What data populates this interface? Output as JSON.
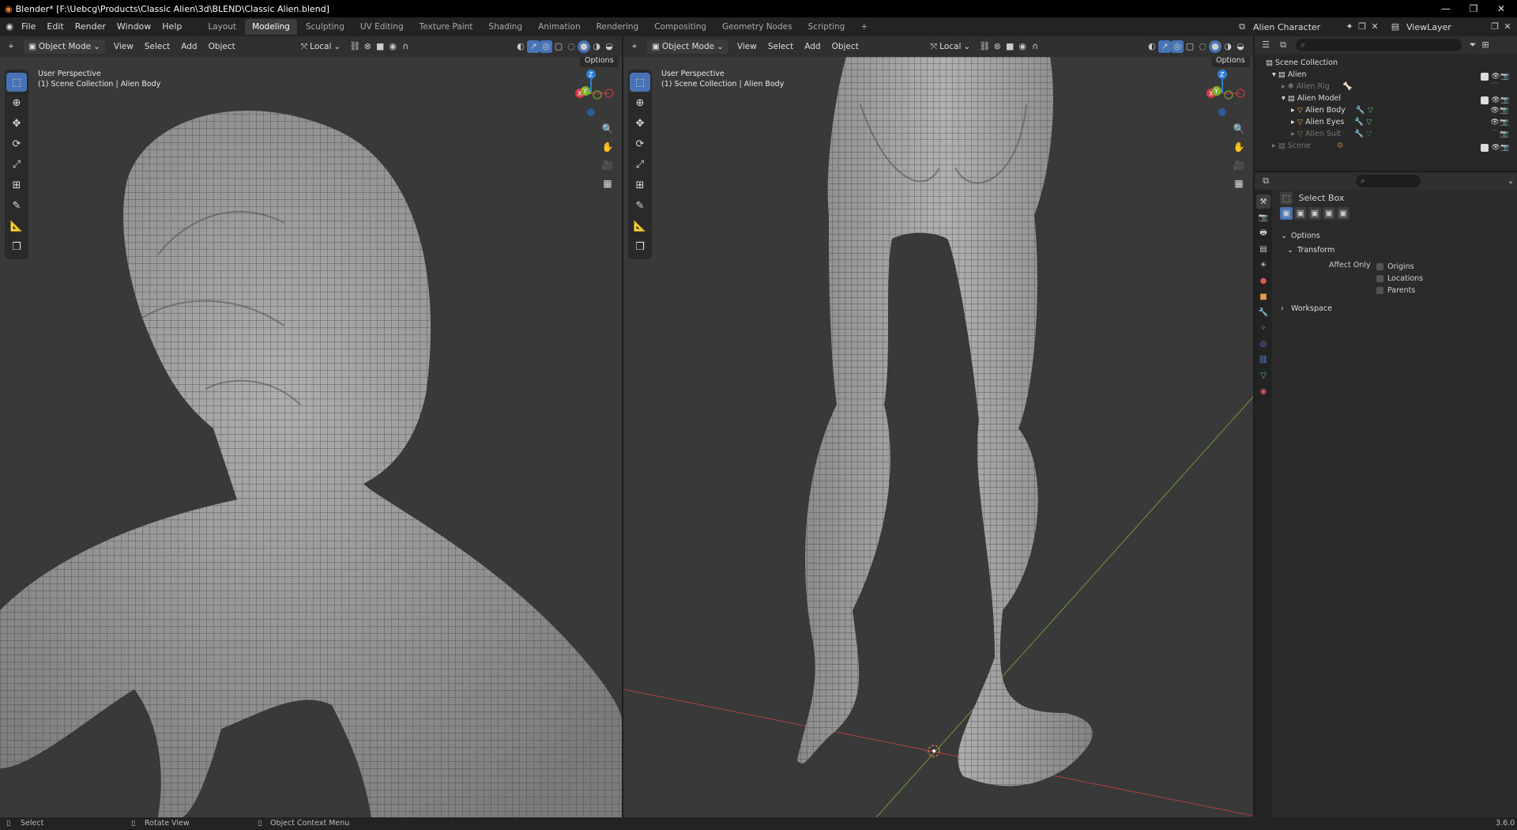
{
  "window": {
    "title": "Blender* [F:\\Uebcg\\Products\\Classic Alien\\3d\\BLEND\\Classic Alien.blend]"
  },
  "menu": [
    "File",
    "Edit",
    "Render",
    "Window",
    "Help"
  ],
  "workspaces": [
    "Layout",
    "Modeling",
    "Sculpting",
    "UV Editing",
    "Texture Paint",
    "Shading",
    "Animation",
    "Rendering",
    "Compositing",
    "Geometry Nodes",
    "Scripting"
  ],
  "active_workspace": "Modeling",
  "scene": {
    "name": "Alien Character",
    "view_layer": "ViewLayer"
  },
  "viewport_header": {
    "mode": "Object Mode",
    "menus": [
      "View",
      "Select",
      "Add",
      "Object"
    ],
    "transform_orientation": "Local",
    "options": "Options"
  },
  "viewports": [
    {
      "perspective": "User Perspective",
      "collection": "(1) Scene Collection | Alien Body"
    },
    {
      "perspective": "User Perspective",
      "collection": "(1) Scene Collection | Alien Body"
    }
  ],
  "gizmo": {
    "z": "Z",
    "y": "Y",
    "x": "X"
  },
  "outliner": {
    "items": [
      {
        "label": "Scene Collection",
        "depth": 0,
        "dim": false
      },
      {
        "label": "Alien",
        "depth": 1,
        "dim": false
      },
      {
        "label": "Alien Rig",
        "depth": 2,
        "dim": true
      },
      {
        "label": "Alien Model",
        "depth": 2,
        "dim": false
      },
      {
        "label": "Alien Body",
        "depth": 3,
        "dim": false
      },
      {
        "label": "Alien Eyes",
        "depth": 3,
        "dim": false
      },
      {
        "label": "Alien Suit",
        "depth": 3,
        "dim": true
      },
      {
        "label": "Scene",
        "depth": 1,
        "dim": true
      }
    ]
  },
  "properties": {
    "tool": "Select Box",
    "options_label": "Options",
    "transform_label": "Transform",
    "affect_only": "Affect Only",
    "checks": [
      "Origins",
      "Locations",
      "Parents"
    ],
    "workspace_label": "Workspace"
  },
  "status": {
    "select": "Select",
    "rotate": "Rotate View",
    "context": "Object Context Menu",
    "version": "3.6.0"
  },
  "colors": {
    "accent": "#4772b3",
    "bg": "#393939",
    "header": "#303030"
  }
}
